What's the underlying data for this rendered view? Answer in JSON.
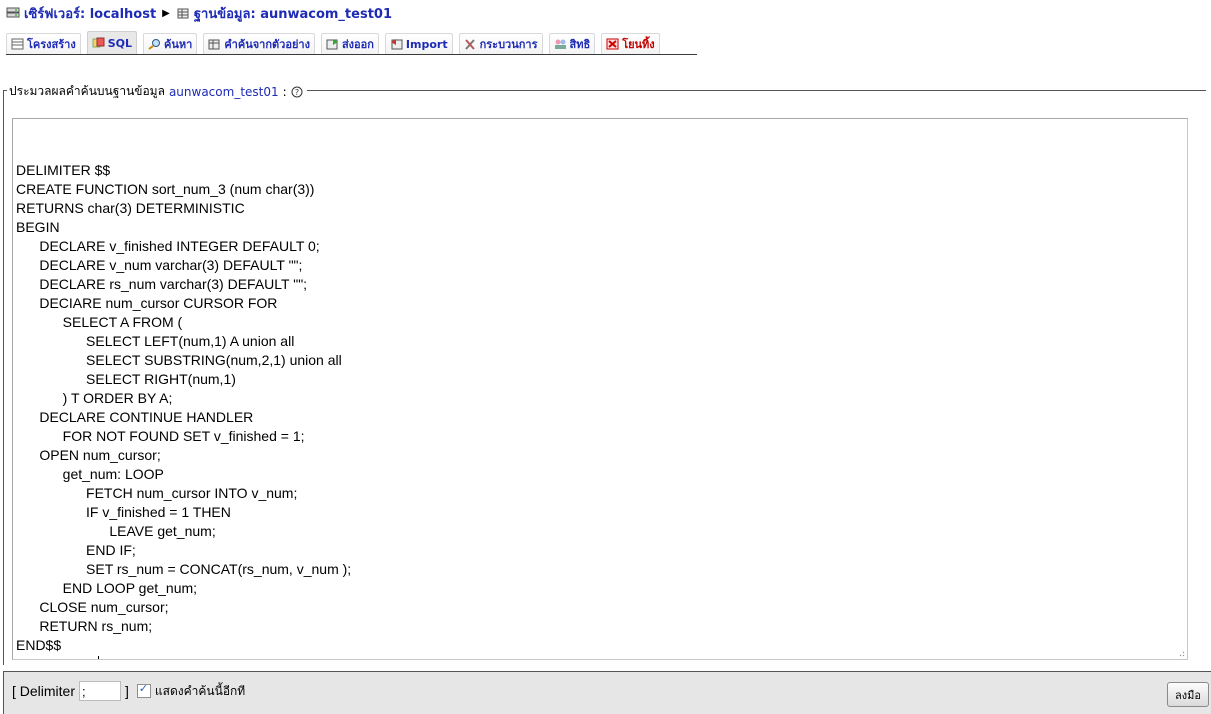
{
  "breadcrumb": {
    "server_label": "เซิร์ฟเวอร์: localhost",
    "database_label": "ฐานข้อมูล: aunwacom_test01"
  },
  "tabs": [
    {
      "label": "โครงสร้าง",
      "icon": "structure-icon",
      "active": false
    },
    {
      "label": "SQL",
      "icon": "sql-icon",
      "active": true
    },
    {
      "label": "ค้นหา",
      "icon": "search-icon",
      "active": false
    },
    {
      "label": "คำค้นจากตัวอย่าง",
      "icon": "query-icon",
      "active": false
    },
    {
      "label": "ส่งออก",
      "icon": "export-icon",
      "active": false
    },
    {
      "label": "Import",
      "icon": "import-icon",
      "active": false
    },
    {
      "label": "กระบวนการ",
      "icon": "operations-icon",
      "active": false
    },
    {
      "label": "สิทธิ",
      "icon": "privileges-icon",
      "active": false
    },
    {
      "label": "โยนทิ้ง",
      "icon": "drop-icon",
      "active": false,
      "color": "#c40000"
    }
  ],
  "sql_panel": {
    "legend_prefix": "ประมวลผลคำค้นบนฐานข้อมูล",
    "database_name": "aunwacom_test01",
    "legend_suffix": ":",
    "help_icon": "help-icon",
    "query_lines": [
      "DELIMITER $$",
      "CREATE FUNCTION sort_num_3 (num char(3))",
      "RETURNS char(3) DETERMINISTIC",
      "BEGIN",
      "      DECLARE v_finished INTEGER DEFAULT 0;",
      "      DECLARE v_num varchar(3) DEFAULT \"\";",
      "      DECLARE rs_num varchar(3) DEFAULT \"\";",
      "      DECIARE num_cursor CURSOR FOR",
      "            SELECT A FROM (",
      "                  SELECT LEFT(num,1) A union all",
      "                  SELECT SUBSTRING(num,2,1) union all",
      "                  SELECT RIGHT(num,1)",
      "            ) T ORDER BY A;",
      "      DECLARE CONTINUE HANDLER",
      "            FOR NOT FOUND SET v_finished = 1;",
      "      OPEN num_cursor;",
      "            get_num: LOOP",
      "                  FETCH num_cursor INTO v_num;",
      "                  IF v_finished = 1 THEN",
      "                        LEAVE get_num;",
      "                  END IF;",
      "                  SET rs_num = CONCAT(rs_num, v_num );",
      "            END LOOP get_num;",
      "      CLOSE num_cursor;",
      "      RETURN rs_num;",
      "END$$",
      "DELIMITER ;"
    ]
  },
  "footer": {
    "delimiter_open": "[ Delimiter",
    "delimiter_value": ";",
    "delimiter_close": "]",
    "show_again_checked": true,
    "show_again_label": "แสดงคำค้นนี้อีกที",
    "go_label": "ลงมือ"
  }
}
